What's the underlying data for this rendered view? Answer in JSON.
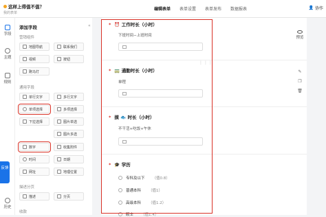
{
  "header": {
    "title": "这样上得值不值？",
    "subtitle": "我的表单",
    "tabs": [
      "编辑表单",
      "表单设置",
      "表单发布",
      "数据报表"
    ],
    "active_tab": 0,
    "collab_label": "协作"
  },
  "rail": {
    "items": [
      {
        "label": "字段",
        "icon": "fields-icon"
      },
      {
        "label": "主题",
        "icon": "theme-icon"
      },
      {
        "label": "规则",
        "icon": "rules-icon"
      },
      {
        "label": "历史",
        "icon": "history-icon"
      }
    ],
    "feedback": "反馈"
  },
  "panel": {
    "title": "添加字段",
    "collapse": "«",
    "sections": [
      {
        "title": "营销组件",
        "fields": [
          "地图导航",
          "联系我们",
          "视频",
          "按钮",
          "跑马灯"
        ]
      },
      {
        "title": "通用字段",
        "fields": [
          "单行文字",
          "多行文字",
          "单项选择",
          "多项选择",
          "下拉选择",
          "图片单选",
          "图片多选",
          "数字",
          "收集附件",
          "时间",
          "日期",
          "网址",
          "地理位置"
        ]
      },
      {
        "title": "描述分页",
        "fields": [
          "描述",
          "分页"
        ]
      },
      {
        "title": "收款"
      }
    ]
  },
  "form": {
    "questions": [
      {
        "num": "*",
        "title": "⏰ 工作时长（小时）",
        "desc": "下班时间−上班时间"
      },
      {
        "num": "*",
        "title": "🚃 通勤时长（小时）",
        "desc": "单程"
      },
      {
        "num": "*",
        "title": "摸 🐟 时长（小时）",
        "desc": "不干活+吃饭+午休"
      },
      {
        "num": "*",
        "title": "🎓 学历",
        "options": [
          {
            "label": "专科及以下",
            "score": "（值0.8）"
          },
          {
            "label": "普通本科",
            "score": "（值1）"
          },
          {
            "label": "高级本科",
            "score": "（值1.2）"
          },
          {
            "label": "硕士",
            "score": "（值1.4）"
          }
        ]
      }
    ],
    "preview_label": "预览",
    "drag_handle": "⋮⋮⋮"
  },
  "colors": {
    "highlight": "#d93025",
    "accent": "#1a73e8"
  }
}
